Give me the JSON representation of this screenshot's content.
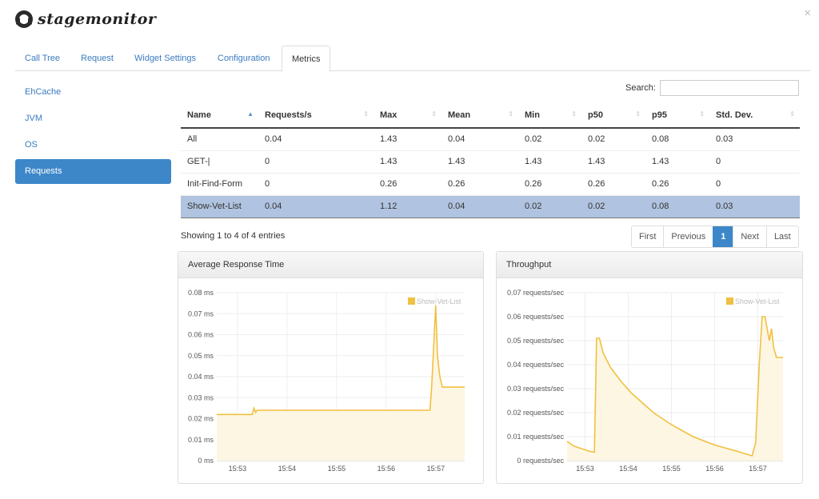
{
  "app": {
    "name": "stagemonitor",
    "close_glyph": "×"
  },
  "tabs": [
    {
      "label": "Call Tree"
    },
    {
      "label": "Request"
    },
    {
      "label": "Widget Settings"
    },
    {
      "label": "Configuration"
    },
    {
      "label": "Metrics",
      "active": true
    }
  ],
  "sidebar": {
    "items": [
      {
        "label": "EhCache"
      },
      {
        "label": "JVM"
      },
      {
        "label": "OS"
      },
      {
        "label": "Requests",
        "active": true
      }
    ]
  },
  "search": {
    "label": "Search:",
    "value": ""
  },
  "table": {
    "columns": [
      "Name",
      "Requests/s",
      "Max",
      "Mean",
      "Min",
      "p50",
      "p95",
      "Std. Dev."
    ],
    "sorted_column": "Name",
    "rows": [
      [
        "All",
        "0.04",
        "1.43",
        "0.04",
        "0.02",
        "0.02",
        "0.08",
        "0.03"
      ],
      [
        "GET-|",
        "0",
        "1.43",
        "1.43",
        "1.43",
        "1.43",
        "1.43",
        "0"
      ],
      [
        "Init-Find-Form",
        "0",
        "0.26",
        "0.26",
        "0.26",
        "0.26",
        "0.26",
        "0"
      ],
      [
        "Show-Vet-List",
        "0.04",
        "1.12",
        "0.04",
        "0.02",
        "0.02",
        "0.08",
        "0.03"
      ]
    ],
    "highlighted_row": 3
  },
  "info": "Showing 1 to 4 of 4 entries",
  "pagination": {
    "first": "First",
    "previous": "Previous",
    "current": "1",
    "next": "Next",
    "last": "Last"
  },
  "colors": {
    "accent": "#3d87c9",
    "series": "#f0c040",
    "series_fill": "#fdf6e3"
  },
  "chart_data": [
    {
      "type": "area",
      "title": "Average Response Time",
      "legend": "Show-Vet-List",
      "legend_position": "top-right",
      "grid": true,
      "ylim": [
        0,
        0.08
      ],
      "yticks": [
        "0 ms",
        "0.01 ms",
        "0.02 ms",
        "0.03 ms",
        "0.04 ms",
        "0.05 ms",
        "0.06 ms",
        "0.07 ms",
        "0.08 ms"
      ],
      "xlim": [
        "15:52:35",
        "15:57:35"
      ],
      "xticks": [
        [
          "15:53",
          "15:53:00"
        ],
        [
          "15:54",
          "15:54:00"
        ],
        [
          "15:55",
          "15:55:00"
        ],
        [
          "15:56",
          "15:56:00"
        ],
        [
          "15:57",
          "15:57:00"
        ]
      ],
      "series": [
        {
          "name": "Show-Vet-List",
          "points": [
            [
              "15:52:35",
              0.022
            ],
            [
              "15:53:18",
              0.022
            ],
            [
              "15:53:20",
              0.025
            ],
            [
              "15:53:22",
              0.023
            ],
            [
              "15:53:24",
              0.024
            ],
            [
              "15:56:53",
              0.024
            ],
            [
              "15:56:55",
              0.035
            ],
            [
              "15:57:00",
              0.074
            ],
            [
              "15:57:02",
              0.05
            ],
            [
              "15:57:05",
              0.04
            ],
            [
              "15:57:08",
              0.035
            ],
            [
              "15:57:35",
              0.035
            ]
          ]
        }
      ]
    },
    {
      "type": "area",
      "title": "Throughput",
      "legend": "Show-Vet-List",
      "legend_position": "top-right",
      "grid": true,
      "ylim": [
        0,
        0.07
      ],
      "yticks": [
        "0 requests/sec",
        "0.01 requests/sec",
        "0.02 requests/sec",
        "0.03 requests/sec",
        "0.04 requests/sec",
        "0.05 requests/sec",
        "0.06 requests/sec",
        "0.07 requests/sec"
      ],
      "xlim": [
        "15:52:35",
        "15:57:35"
      ],
      "xticks": [
        [
          "15:53",
          "15:53:00"
        ],
        [
          "15:54",
          "15:54:00"
        ],
        [
          "15:55",
          "15:55:00"
        ],
        [
          "15:56",
          "15:56:00"
        ],
        [
          "15:57",
          "15:57:00"
        ]
      ],
      "series": [
        {
          "name": "Show-Vet-List",
          "points": [
            [
              "15:52:35",
              0.008
            ],
            [
              "15:52:45",
              0.006
            ],
            [
              "15:52:55",
              0.005
            ],
            [
              "15:53:05",
              0.004
            ],
            [
              "15:53:13",
              0.0035
            ],
            [
              "15:53:16",
              0.051
            ],
            [
              "15:53:20",
              0.051
            ],
            [
              "15:53:25",
              0.045
            ],
            [
              "15:53:35",
              0.039
            ],
            [
              "15:53:50",
              0.033
            ],
            [
              "15:54:05",
              0.028
            ],
            [
              "15:54:20",
              0.024
            ],
            [
              "15:54:35",
              0.02
            ],
            [
              "15:55:00",
              0.015
            ],
            [
              "15:55:30",
              0.01
            ],
            [
              "15:56:00",
              0.0065
            ],
            [
              "15:56:30",
              0.004
            ],
            [
              "15:56:52",
              0.002
            ],
            [
              "15:56:57",
              0.0075
            ],
            [
              "15:57:02",
              0.04
            ],
            [
              "15:57:06",
              0.06
            ],
            [
              "15:57:10",
              0.06
            ],
            [
              "15:57:13",
              0.055
            ],
            [
              "15:57:16",
              0.05
            ],
            [
              "15:57:19",
              0.055
            ],
            [
              "15:57:22",
              0.047
            ],
            [
              "15:57:26",
              0.043
            ],
            [
              "15:57:35",
              0.043
            ]
          ]
        }
      ]
    }
  ]
}
